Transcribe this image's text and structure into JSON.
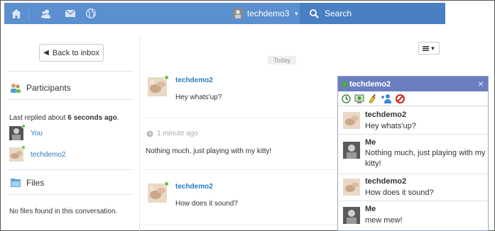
{
  "nav": {
    "icons": [
      "home-icon",
      "users-icon",
      "mail-icon",
      "globe-icon"
    ],
    "username": "techdemo3",
    "search_label": "Search"
  },
  "sidebar": {
    "back_label": "Back to inbox",
    "participants_title": "Participants",
    "last_replied_prefix": "Last replied about ",
    "last_replied_bold": "6 seconds ago",
    "last_replied_suffix": ".",
    "participants": [
      {
        "name": "You"
      },
      {
        "name": "techdemo2"
      }
    ],
    "files_title": "Files",
    "no_files": "No files found in this conversation."
  },
  "conversation": {
    "date_label": "Today",
    "time_label": "1 minute ago",
    "messages": [
      {
        "author": "techdemo2",
        "text": "Hey whats'up?"
      },
      {
        "author": "",
        "text": "Nothing much, just playing with my kitty!"
      },
      {
        "author": "techdemo2",
        "text": "How does it sound?"
      }
    ]
  },
  "chat": {
    "title": "techdemo2",
    "close_glyph": "×",
    "tools": [
      "history-icon",
      "screen-icon",
      "clear-icon",
      "add-user-icon",
      "block-icon"
    ],
    "messages": [
      {
        "sender": "techdemo2",
        "text": "Hey whats'up?"
      },
      {
        "sender": "Me",
        "text": "Nothing much, just playing with my kitty!"
      },
      {
        "sender": "techdemo2",
        "text": "How does it sound?"
      },
      {
        "sender": "Me",
        "text": "mew mew!"
      }
    ]
  },
  "colors": {
    "topbar": "#5b8fcf",
    "search_bg": "#4a7fc4",
    "link": "#2a7bbd",
    "chat_header": "#6b7ec0",
    "online": "#6ac23a"
  }
}
